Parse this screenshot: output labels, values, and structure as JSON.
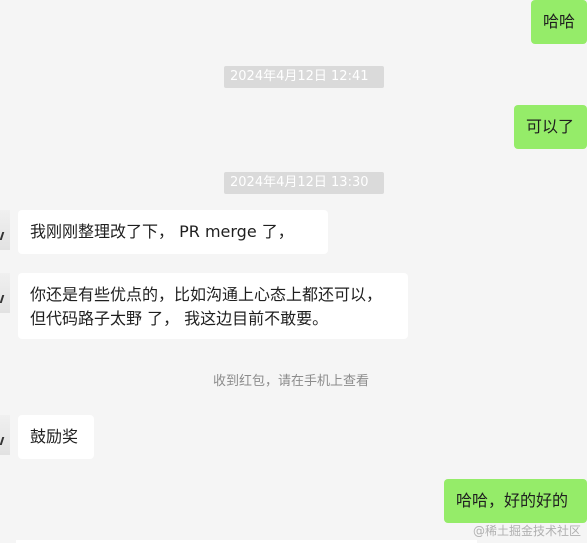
{
  "messages": {
    "out_hh1": "哈哈",
    "time1": "2024年4月12日 12:41",
    "out_ky": "可以了",
    "time2": "2024年4月12日 13:30",
    "in_pr": "我刚刚整理改了下， PR merge 了，",
    "in_long": "你还是有些优点的，比如沟通上心态上都还可以， 但代码路子太野 了， 我这边目前不敢要。",
    "sys_redpacket": "收到红包，请在手机上查看",
    "in_reward": "鼓励奖",
    "out_hh2": "哈哈，好的好的"
  },
  "watermark": "@稀土掘金技术社区",
  "colors": {
    "outgoing_bubble": "#95ec69",
    "incoming_bubble": "#ffffff",
    "background": "#f5f5f5"
  }
}
